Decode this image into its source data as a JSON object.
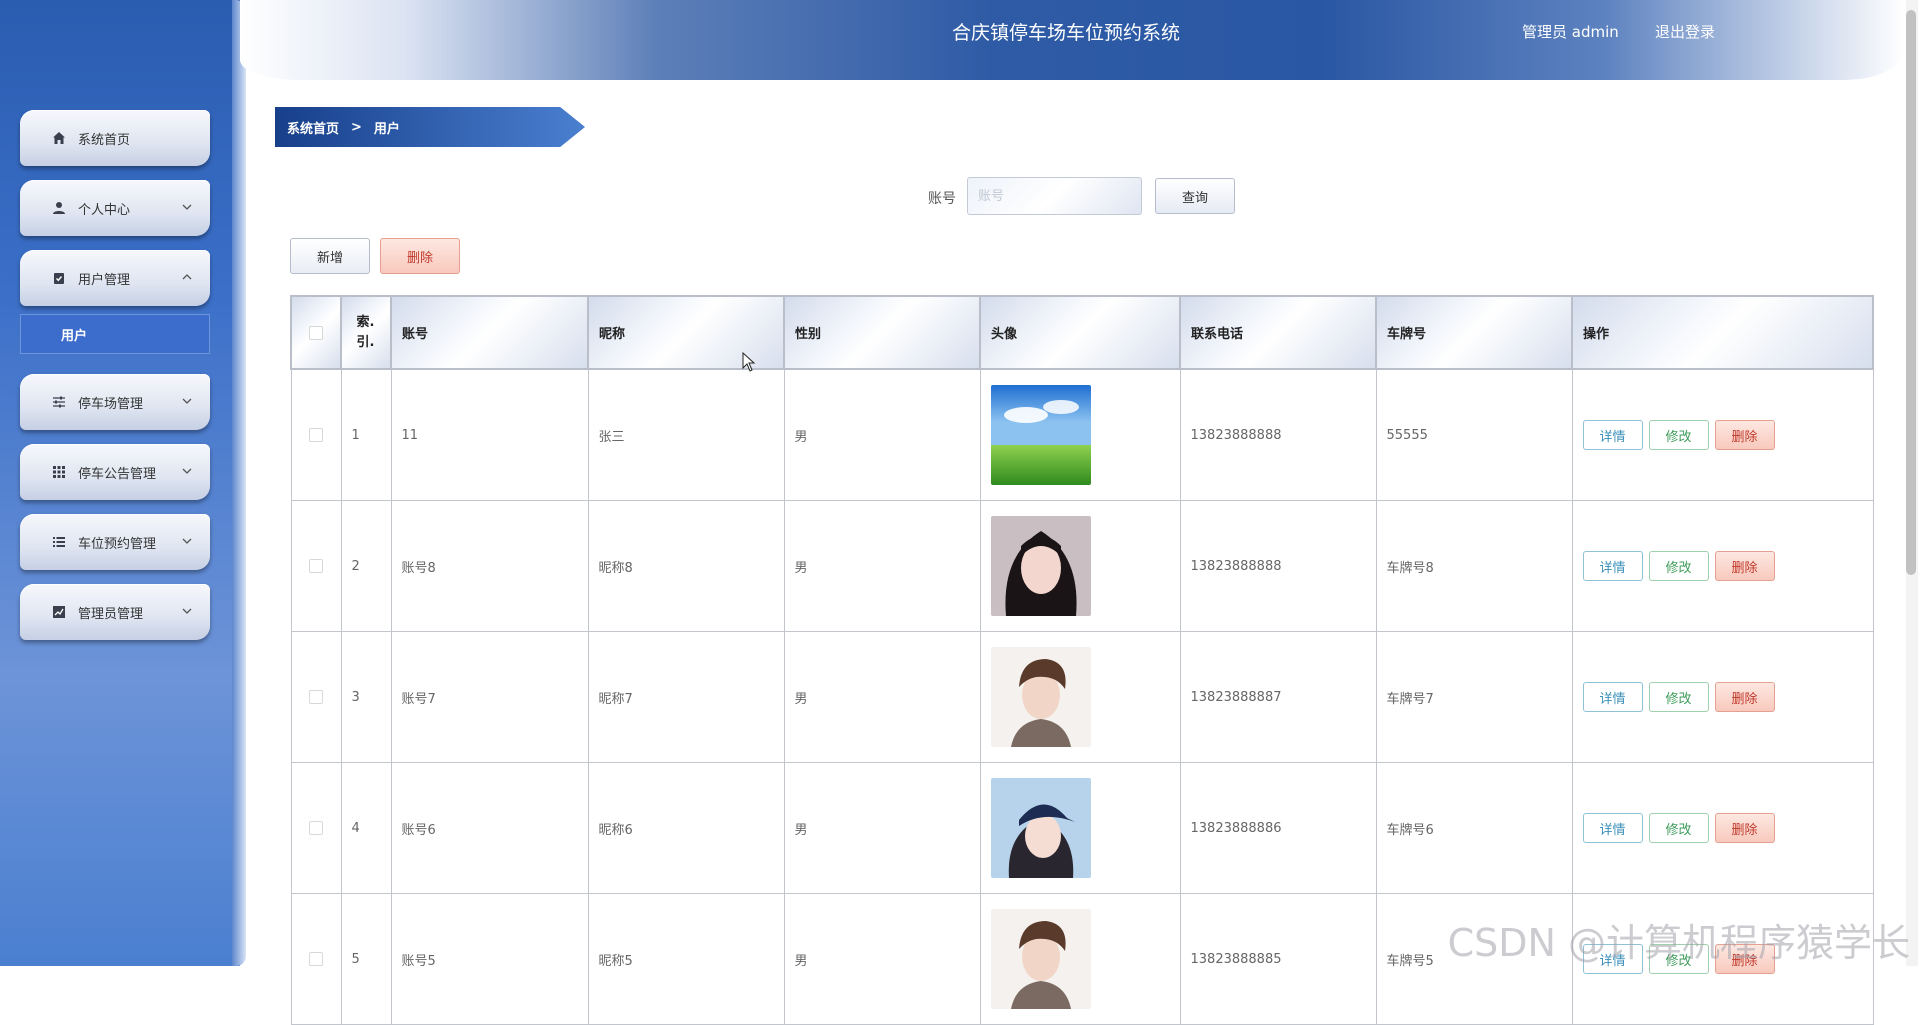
{
  "header": {
    "title": "合庆镇停车场车位预约系统",
    "admin": "管理员 admin",
    "logout": "退出登录"
  },
  "sidebar": {
    "items": [
      {
        "label": "系统首页",
        "icon": "home-icon",
        "chevron": false
      },
      {
        "label": "个人中心",
        "icon": "user-icon",
        "chevron": true
      },
      {
        "label": "用户管理",
        "icon": "clipboard-icon",
        "chevron": true,
        "expanded": true
      },
      {
        "label": "停车场管理",
        "icon": "sliders-icon",
        "chevron": true
      },
      {
        "label": "停车公告管理",
        "icon": "grid-icon",
        "chevron": true
      },
      {
        "label": "车位预约管理",
        "icon": "list-icon",
        "chevron": true
      },
      {
        "label": "管理员管理",
        "icon": "chart-icon",
        "chevron": true
      }
    ],
    "active_sub": "用户"
  },
  "breadcrumb": {
    "home": "系统首页",
    "sep": ">",
    "current": "用户"
  },
  "search": {
    "label": "账号",
    "placeholder": "账号",
    "query_btn": "查询"
  },
  "actions": {
    "add": "新增",
    "delete": "删除"
  },
  "table": {
    "headers": {
      "check": "",
      "index": "索.\n引.",
      "account": "账号",
      "nickname": "昵称",
      "gender": "性别",
      "avatar": "头像",
      "phone": "联系电话",
      "plate": "车牌号",
      "ops": "操作"
    },
    "rows": [
      {
        "index": "1",
        "account": "11",
        "nickname": "张三",
        "gender": "男",
        "avatar": "sky-landscape",
        "phone": "13823888888",
        "plate": "55555"
      },
      {
        "index": "2",
        "account": "账号8",
        "nickname": "昵称8",
        "gender": "男",
        "avatar": "woman-portrait",
        "phone": "13823888888",
        "plate": "车牌号8"
      },
      {
        "index": "3",
        "account": "账号7",
        "nickname": "昵称7",
        "gender": "男",
        "avatar": "man-portrait",
        "phone": "13823888887",
        "plate": "车牌号7"
      },
      {
        "index": "4",
        "account": "账号6",
        "nickname": "昵称6",
        "gender": "男",
        "avatar": "woman-cap-portrait",
        "phone": "13823888886",
        "plate": "车牌号6"
      },
      {
        "index": "5",
        "account": "账号5",
        "nickname": "昵称5",
        "gender": "男",
        "avatar": "man-portrait",
        "phone": "13823888885",
        "plate": "车牌号5"
      }
    ],
    "op_labels": {
      "detail": "详情",
      "edit": "修改",
      "delete": "删除"
    }
  },
  "watermark": "CSDN @计算机程序猿学长"
}
